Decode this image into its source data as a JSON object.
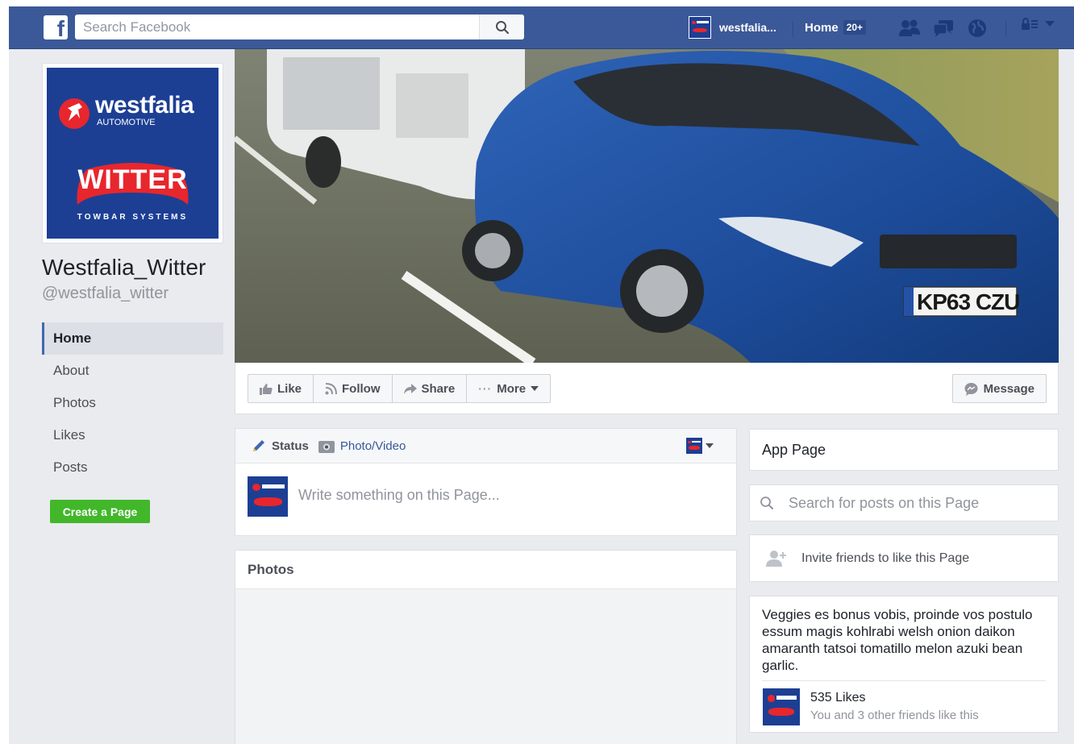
{
  "topbar": {
    "logo": "f",
    "search_placeholder": "Search Facebook",
    "profile_name": "westfalia...",
    "home_label": "Home",
    "home_badge": "20+",
    "icons": [
      "friends-icon",
      "messages-icon",
      "globe-icon",
      "settings-icon",
      "caret-down-icon"
    ]
  },
  "profile": {
    "logo_brand": "westfalia",
    "logo_sub": "AUTOMOTIVE",
    "logo_witter": "WITTER",
    "logo_towbar": "TOWBAR SYSTEMS",
    "name": "Westfalia_Witter",
    "handle": "@westfalia_witter"
  },
  "left_nav": {
    "items": [
      {
        "label": "Home",
        "active": true
      },
      {
        "label": "About"
      },
      {
        "label": "Photos"
      },
      {
        "label": "Likes"
      },
      {
        "label": "Posts"
      }
    ],
    "create_button": "Create a Page"
  },
  "cover": {
    "plate": "KP63 CZU"
  },
  "actions": {
    "like": "Like",
    "follow": "Follow",
    "share": "Share",
    "more": "More",
    "message": "Message"
  },
  "composer": {
    "status_tab": "Status",
    "photo_tab": "Photo/Video",
    "placeholder": "Write something on this Page..."
  },
  "photos": {
    "title": "Photos"
  },
  "sidebar": {
    "app_page": "App Page",
    "search_placeholder": "Search for posts on this Page",
    "invite": "Invite friends to like this Page",
    "about_text": "Veggies es bonus vobis, proinde vos postulo essum magis kohlrabi welsh onion daikon amaranth tatsoi tomatillo melon azuki bean garlic.",
    "likes_count": "535 Likes",
    "likes_sub": "You and 3 other friends like this"
  },
  "colors": {
    "brand_blue": "#3b5998",
    "logo_blue": "#1c3f94",
    "logo_red": "#e8262d",
    "green": "#42b72a"
  }
}
